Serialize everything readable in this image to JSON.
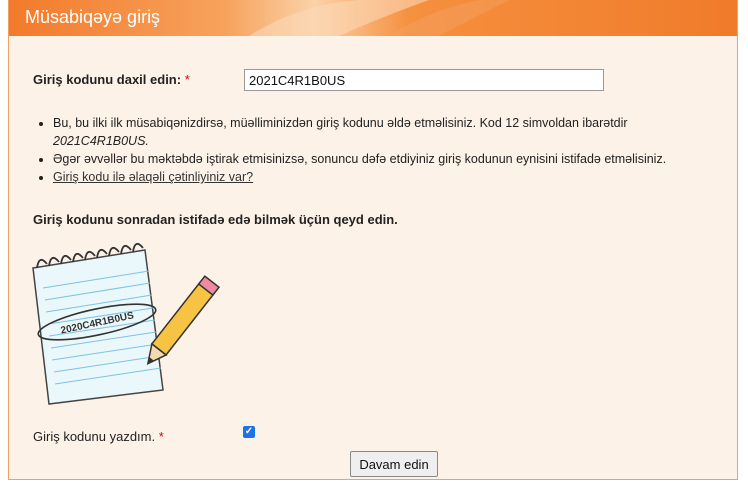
{
  "header": {
    "title": "Müsabiqəyə giriş"
  },
  "form": {
    "code_label": "Giriş kodunu daxil edin:",
    "required_mark": "*",
    "code_value": "2021C4R1B0US",
    "confirm_label": "Giriş kodunu yazdım.",
    "confirm_checked": true,
    "submit_label": "Davam edin"
  },
  "info": {
    "item1_text": "Bu, bu ilki ilk müsabiqənizdirsə, müəlliminizdən giriş kodunu əldə etməlisiniz. Kod 12 simvoldan ibarətdir",
    "item1_example": "2021C4R1B0US.",
    "item2_text": "Əgər əvvəllər bu məktəbdə iştirak etmisinizsə, sonuncu dəfə etdiyiniz giriş kodunun eynisini istifadə etməlisiniz.",
    "item3_link": "Giriş kodu ilə əlaqəli çətinliyiniz var?"
  },
  "note": "Giriş kodunu sonradan istifadə edə bilmək üçün qeyd edin.",
  "illustration": {
    "notepad_code": "2020C4R1B0US"
  },
  "colors": {
    "header": "#f37a2a",
    "panel_bg": "#fdf2e8",
    "required": "#d0021b",
    "checkbox": "#1a73e8"
  }
}
